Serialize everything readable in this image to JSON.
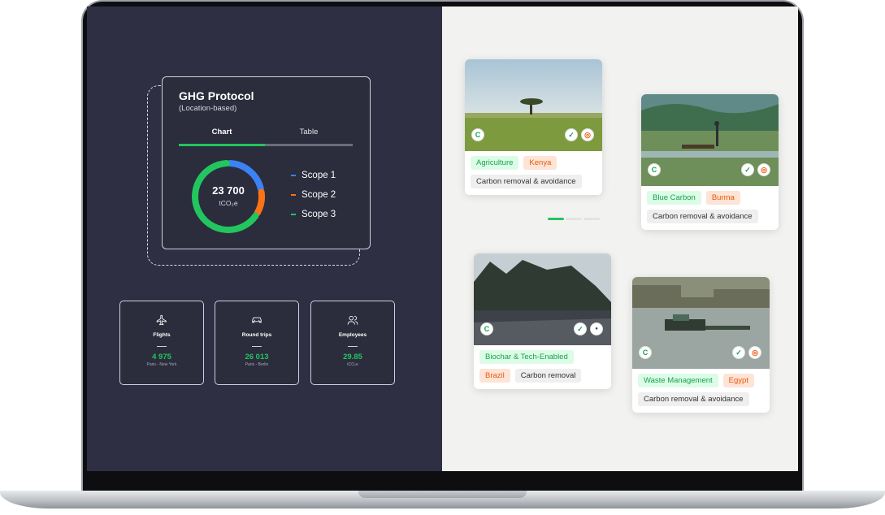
{
  "ghg": {
    "title": "GHG Protocol",
    "subtitle": "(Location-based)",
    "tabs": [
      "Chart",
      "Table"
    ],
    "active_tab": "Chart",
    "total_value": "23 700",
    "total_unit": "tCO₂e",
    "legend": [
      {
        "label": "Scope 1",
        "color": "#3b82f6"
      },
      {
        "label": "Scope 2",
        "color": "#f97316"
      },
      {
        "label": "Scope 3",
        "color": "#22c55e"
      }
    ]
  },
  "chart_data": {
    "type": "pie",
    "categories": [
      "Scope 1",
      "Scope 2",
      "Scope 3"
    ],
    "values": [
      22,
      12,
      66
    ],
    "title": "GHG Protocol",
    "colors": [
      "#3b82f6",
      "#f97316",
      "#22c55e"
    ]
  },
  "stats": [
    {
      "icon": "airplane-icon",
      "label": "Flights",
      "value": "4 975",
      "sub": "Paris - New York"
    },
    {
      "icon": "car-icon",
      "label": "Round trips",
      "value": "26 013",
      "sub": "Paris - Berlin"
    },
    {
      "icon": "users-icon",
      "label": "Employees",
      "value": "29.85",
      "sub": "tCO₂e"
    }
  ],
  "projects": [
    {
      "image": "savanna-tree",
      "tags_row1": [
        {
          "text": "Agriculture",
          "style": "green"
        },
        {
          "text": "Kenya",
          "style": "orange"
        }
      ],
      "tags_row2": [
        {
          "text": "Carbon removal & avoidance",
          "style": "grey"
        }
      ]
    },
    {
      "image": "lake-boat",
      "tags_row1": [
        {
          "text": "Blue Carbon",
          "style": "green"
        },
        {
          "text": "Burma",
          "style": "orange"
        }
      ],
      "tags_row2": [
        {
          "text": "Carbon removal & avoidance",
          "style": "grey"
        }
      ]
    },
    {
      "image": "basalt-cliff",
      "tags_row1": [
        {
          "text": "Biochar & Tech-Enabled",
          "style": "green"
        }
      ],
      "tags_row2": [
        {
          "text": "Brazil",
          "style": "orange"
        },
        {
          "text": "Carbon removal",
          "style": "grey"
        }
      ]
    },
    {
      "image": "river-barge",
      "tags_row1": [
        {
          "text": "Waste Management",
          "style": "green"
        },
        {
          "text": "Egypt",
          "style": "orange"
        }
      ],
      "tags_row2": [
        {
          "text": "Carbon removal & avoidance",
          "style": "grey"
        }
      ]
    }
  ],
  "carousel": {
    "pages": 3,
    "active": 0
  },
  "colors": {
    "accent": "#22c55e",
    "dark_panel": "#2e2f42",
    "light_panel": "#f2f2f0"
  }
}
